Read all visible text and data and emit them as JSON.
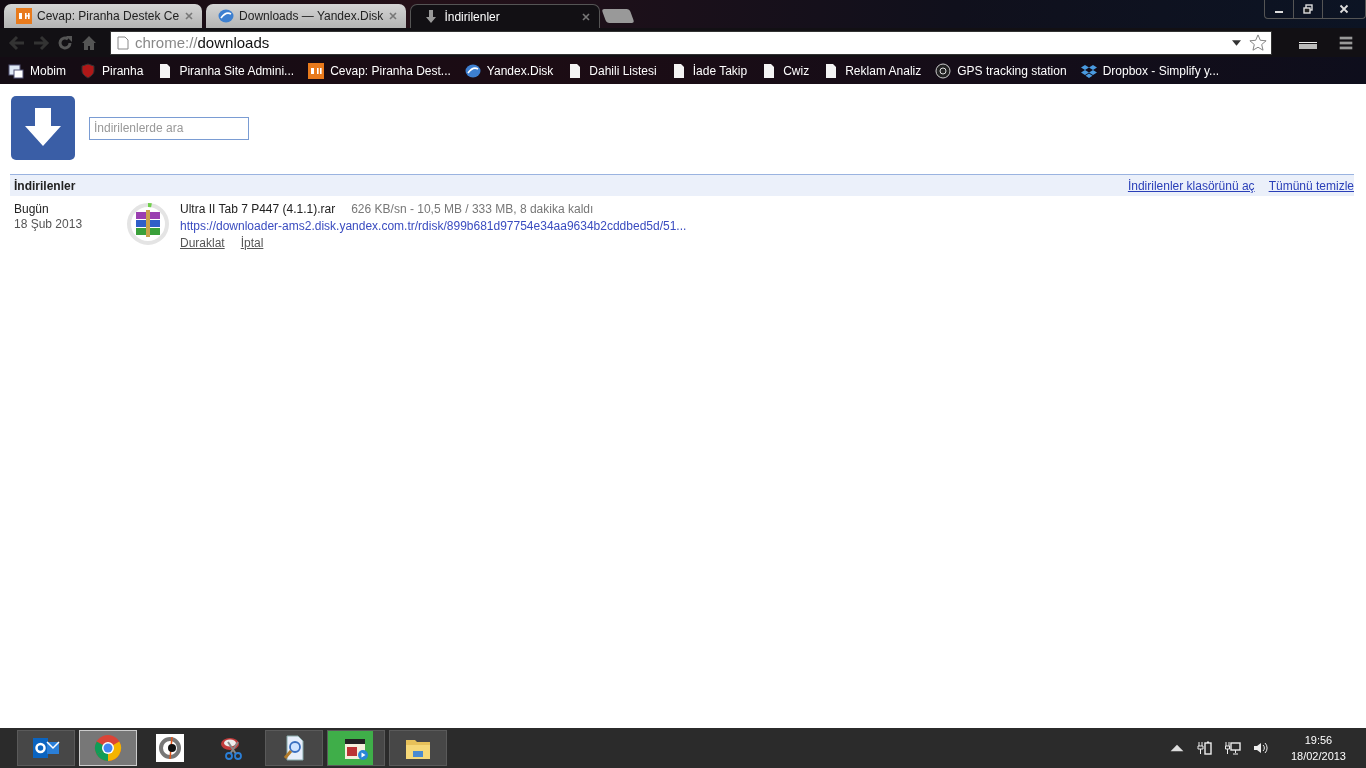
{
  "tabs": [
    {
      "kind": "dh",
      "title": "Cevap: Piranha Destek Ce",
      "selected": false
    },
    {
      "kind": "disk",
      "title": "Downloads — Yandex.Disk",
      "selected": false
    },
    {
      "kind": "download",
      "title": "İndirilenler",
      "selected": true
    }
  ],
  "omnibox": {
    "scheme": "chrome://",
    "path": "downloads"
  },
  "bookmarks": [
    {
      "kind": "app",
      "label": "Mobim"
    },
    {
      "kind": "shield",
      "label": "Piranha"
    },
    {
      "kind": "page",
      "label": "Piranha Site Admini..."
    },
    {
      "kind": "dh",
      "label": "Cevap: Piranha Dest..."
    },
    {
      "kind": "disk",
      "label": "Yandex.Disk"
    },
    {
      "kind": "page",
      "label": "Dahili Listesi"
    },
    {
      "kind": "page",
      "label": "İade Takip"
    },
    {
      "kind": "page",
      "label": "Cwiz"
    },
    {
      "kind": "page",
      "label": "Reklam Analiz"
    },
    {
      "kind": "ng",
      "label": "GPS tracking station"
    },
    {
      "kind": "dropbox",
      "label": "Dropbox - Simplify y..."
    }
  ],
  "search": {
    "placeholder": "İndirilenlerde ara"
  },
  "section": {
    "title": "İndirilenler",
    "links": [
      "İndirilenler klasörünü aç",
      "Tümünü temizle"
    ]
  },
  "downloads": [
    {
      "day": "Bugün",
      "date": "18 Şub 2013",
      "name": "Ultra II Tab 7 P447 (4.1.1).rar",
      "status": "626 KB/sn - 10,5 MB / 333 MB, 8 dakika kaldı",
      "url": "https://downloader-ams2.disk.yandex.com.tr/rdisk/899b681d97754e34aa9634b2cddbed5d/51...",
      "level": 0.03,
      "actions": [
        "Duraklat",
        "İptal"
      ]
    }
  ],
  "taskbar": {
    "apps": [
      {
        "kind": "outlook",
        "open": true,
        "selected": false
      },
      {
        "kind": "chrome",
        "open": true,
        "selected": true
      },
      {
        "kind": "ccleaner",
        "open": false,
        "selected": false
      },
      {
        "kind": "snip",
        "open": false,
        "selected": false
      },
      {
        "kind": "magnifier",
        "open": true,
        "selected": false
      },
      {
        "kind": "media",
        "open": true,
        "selected": false,
        "level": 0.8
      },
      {
        "kind": "folder",
        "open": true,
        "selected": false
      }
    ],
    "time": "19:56",
    "date": "18/02/2013"
  }
}
